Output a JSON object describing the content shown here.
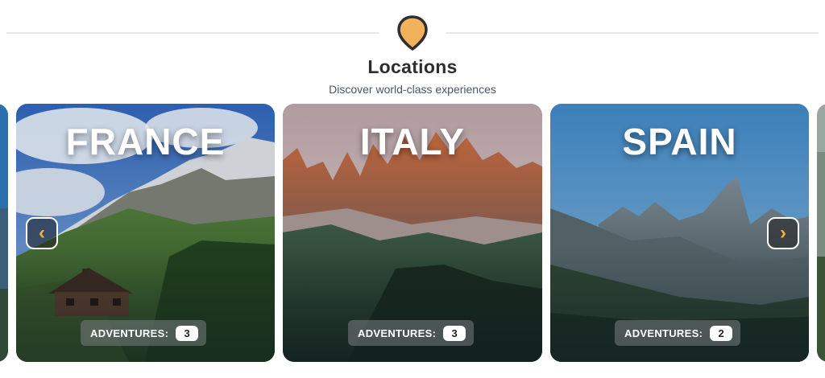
{
  "section": {
    "title": "Locations",
    "subtitle": "Discover world-class experiences",
    "pin_color": "#F2B25B"
  },
  "carousel": {
    "prev_icon": "‹",
    "next_icon": "›",
    "cards": [
      {
        "name": "FRANCE",
        "adventures_label": "ADVENTURES:",
        "adventures_count": "3"
      },
      {
        "name": "ITALY",
        "adventures_label": "ADVENTURES:",
        "adventures_count": "3"
      },
      {
        "name": "SPAIN",
        "adventures_label": "ADVENTURES:",
        "adventures_count": "2"
      }
    ]
  }
}
